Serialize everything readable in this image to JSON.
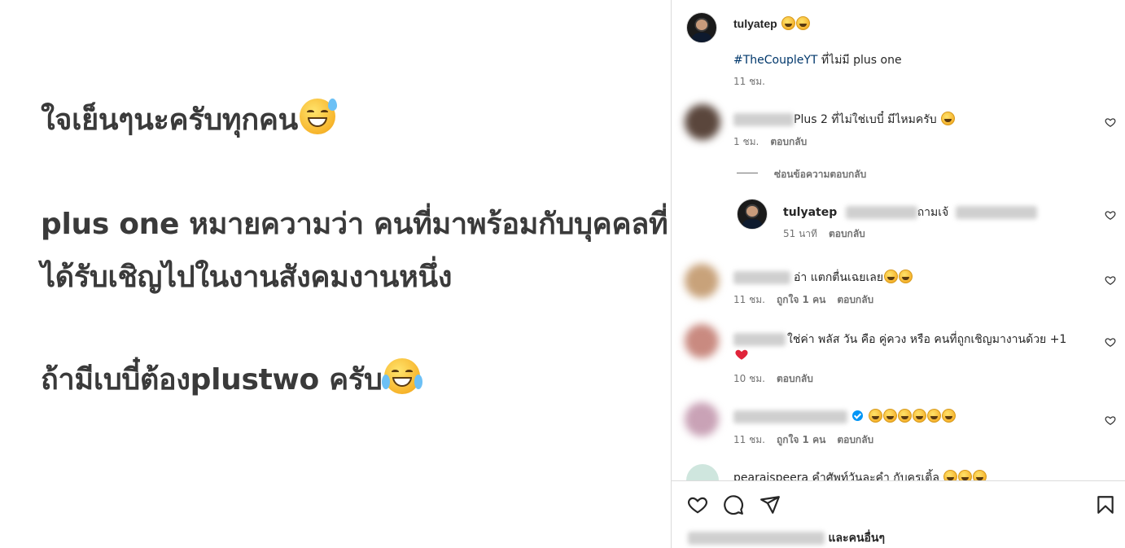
{
  "post": {
    "line1": "ใจเย็นๆนะครับทุกคน",
    "line2": "plus one หมายความว่า คนที่มาพร้อมกับบุคคลที่",
    "line3": "ได้รับเชิญไปในงานสังคมงานหนึ่ง",
    "line4": "ถ้ามีเบบี๋ต้องplustwo ครับ"
  },
  "header": {
    "username": "tulyatep",
    "caption_hashtag": "#TheCoupleYT",
    "caption_text": " ที่ไม่มี plus one",
    "caption_time": "11 ชม."
  },
  "comments": [
    {
      "text": "Plus 2 ที่ไม่ใช่เบบี๋ มีไหมครับ",
      "time": "1 ชม.",
      "reply": "ตอบกลับ"
    },
    {
      "hide_replies": "ซ่อนข้อความตอบกลับ"
    },
    {
      "username": "tulyatep",
      "text": "ถามเจ้",
      "time": "51 นาที",
      "reply": "ตอบกลับ"
    },
    {
      "text": "อ่า แตกตื่นเฉยเลย",
      "time": "11 ชม.",
      "likes": "ถูกใจ 1 คน",
      "reply": "ตอบกลับ"
    },
    {
      "text": "ใช่ค่า พลัส วัน คือ คู่ควง หรือ คนที่ถูกเชิญมางานด้วย +1",
      "time": "10 ชม.",
      "reply": "ตอบกลับ"
    },
    {
      "text": "",
      "time": "11 ชม.",
      "likes": "ถูกใจ 1 คน",
      "reply": "ตอบกลับ"
    },
    {
      "text": "pearaispeera คำศัพท์วันละคำ กับครูเติ้ล"
    }
  ],
  "footer": {
    "likes_suffix": "และคนอื่นๆ"
  },
  "icons": [
    "heart-icon",
    "comment-icon",
    "share-icon",
    "bookmark-icon",
    "verified-icon"
  ],
  "colors": {
    "hashtag": "#00376b",
    "meta": "#737373",
    "verified": "#0095f6",
    "red_heart": "#ed4956"
  }
}
